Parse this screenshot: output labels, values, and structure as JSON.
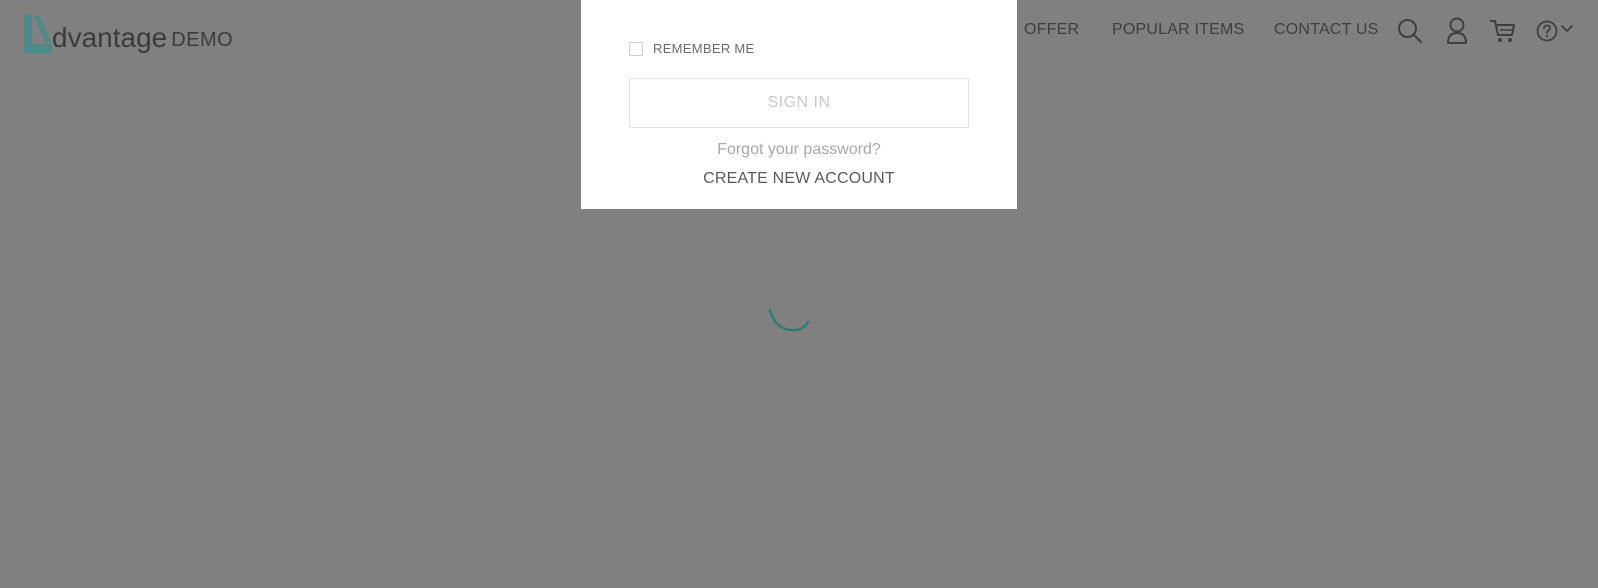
{
  "header": {
    "logo": {
      "mark": "A",
      "word": "dvantage",
      "suffix": "DEMO",
      "mark_color": "#4e8a88"
    },
    "nav": {
      "items": [
        {
          "label": "OFFER"
        },
        {
          "label": "POPULAR ITEMS"
        },
        {
          "label": "CONTACT US"
        }
      ]
    },
    "icons": [
      "search-icon",
      "user-icon",
      "cart-icon",
      "help-icon",
      "chevron-down-icon"
    ]
  },
  "login_modal": {
    "remember_me_label": "REMEMBER ME",
    "remember_me_checked": false,
    "sign_in_label": "SIGN IN",
    "forgot_password_label": "Forgot your password?",
    "create_account_label": "CREATE NEW ACCOUNT"
  },
  "overlay_color": "#808080",
  "spinner_color": "#2f7b77"
}
